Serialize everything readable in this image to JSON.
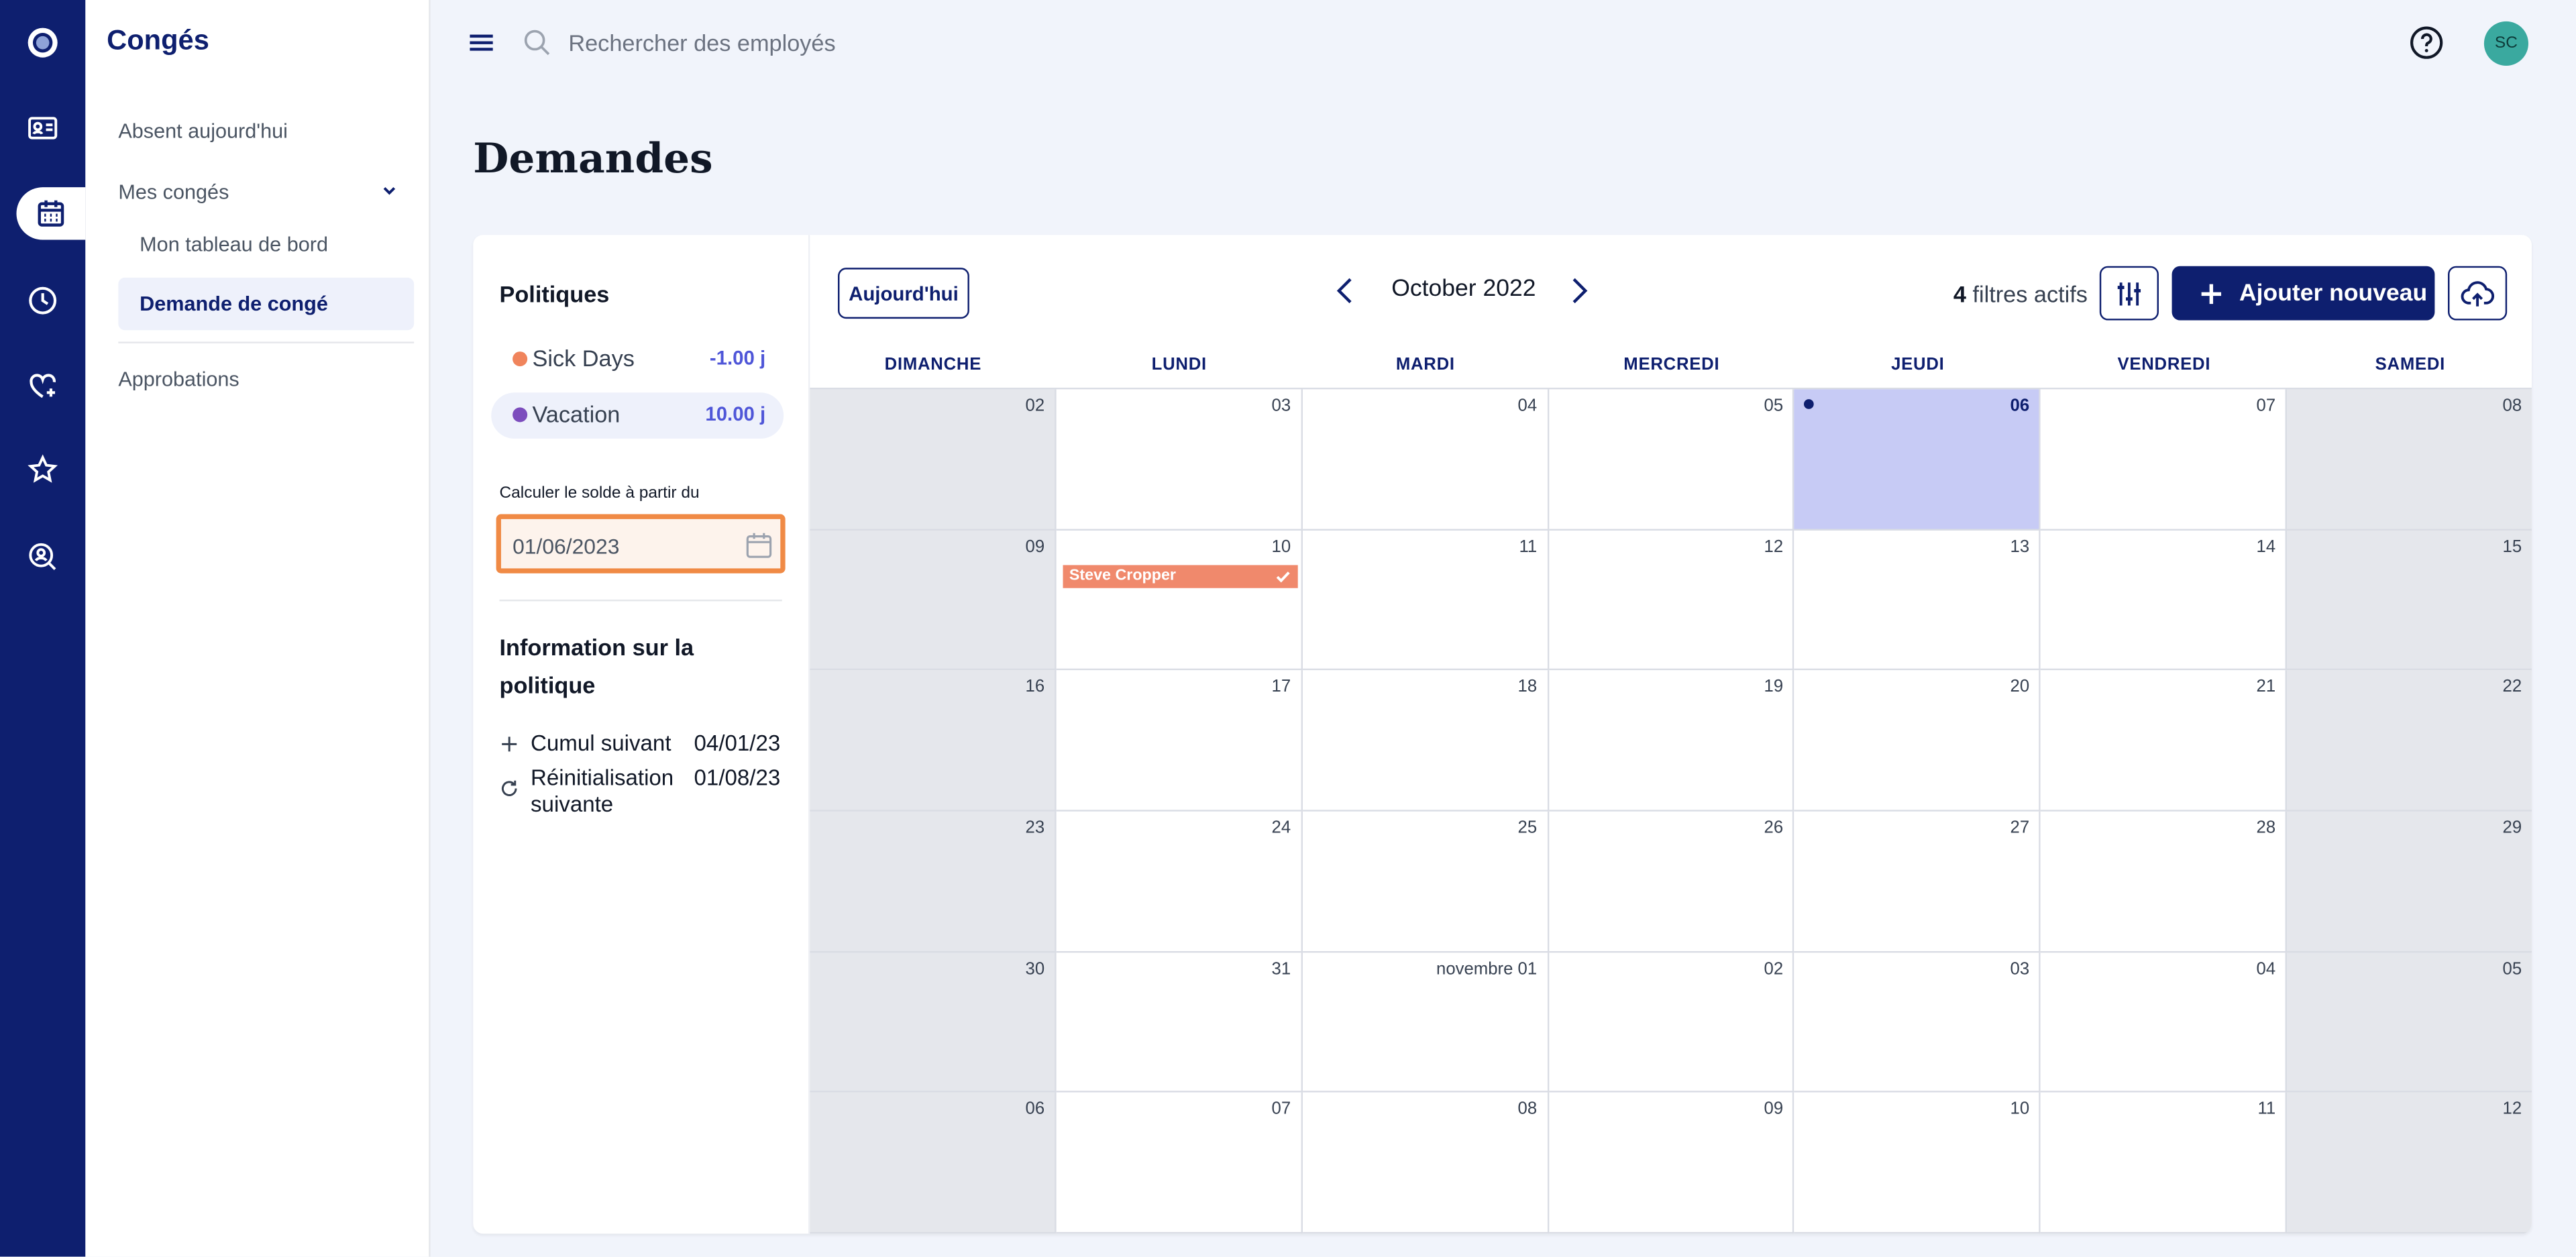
{
  "rail": {
    "items": [
      {
        "name": "logo-icon"
      },
      {
        "name": "id-card-icon"
      },
      {
        "name": "calendar-icon",
        "active": true
      },
      {
        "name": "clock-icon"
      },
      {
        "name": "heart-plus-icon"
      },
      {
        "name": "star-icon"
      },
      {
        "name": "search-person-icon"
      }
    ]
  },
  "sidebar": {
    "title": "Congés",
    "absent_today": "Absent aujourd'hui",
    "my_leave": "Mes congés",
    "dashboard": "Mon tableau de bord",
    "leave_request": "Demande de congé",
    "approvals": "Approbations"
  },
  "topbar": {
    "search_placeholder": "Rechercher des employés",
    "avatar_initials": "SC"
  },
  "page": {
    "title": "Demandes"
  },
  "policies": {
    "title": "Politiques",
    "items": [
      {
        "name": "Sick Days",
        "value": "-1.00 j",
        "color": "#f0845c"
      },
      {
        "name": "Vacation",
        "value": "10.00 j",
        "color": "#7c4dbd"
      }
    ],
    "calc_label": "Calculer le solde à partir du",
    "calc_date": "01/06/2023",
    "info_title": "Information sur la politique",
    "info": [
      {
        "label": "Cumul suivant",
        "value": "04/01/23",
        "icon": "plus-icon"
      },
      {
        "label": "Réinitialisation suivante",
        "value": "01/08/23",
        "icon": "refresh-icon"
      }
    ]
  },
  "calendar": {
    "today_button": "Aujourd'hui",
    "month_label": "October 2022",
    "filters_count": "4",
    "filters_text": "filtres actifs",
    "add_button": "Ajouter nouveau",
    "weekdays": [
      "DIMANCHE",
      "LUNDI",
      "MARDI",
      "MERCREDI",
      "JEUDI",
      "VENDREDI",
      "SAMEDI"
    ],
    "weeks": [
      [
        "02",
        "03",
        "04",
        "05",
        "06",
        "07",
        "08"
      ],
      [
        "09",
        "10",
        "11",
        "12",
        "13",
        "14",
        "15"
      ],
      [
        "16",
        "17",
        "18",
        "19",
        "20",
        "21",
        "22"
      ],
      [
        "23",
        "24",
        "25",
        "26",
        "27",
        "28",
        "29"
      ],
      [
        "30",
        "31",
        "novembre 01",
        "02",
        "03",
        "04",
        "05"
      ],
      [
        "06",
        "07",
        "08",
        "09",
        "10",
        "11",
        "12"
      ]
    ],
    "today": {
      "week": 0,
      "day": 4
    },
    "events": [
      {
        "week": 1,
        "day": 1,
        "label": "Steve Cropper",
        "color": "#f0896c",
        "approved": true
      }
    ],
    "colors": {
      "accent": "#0e1f6f",
      "today": "#c7cbf5",
      "weekend": "#e5e7ec"
    }
  }
}
